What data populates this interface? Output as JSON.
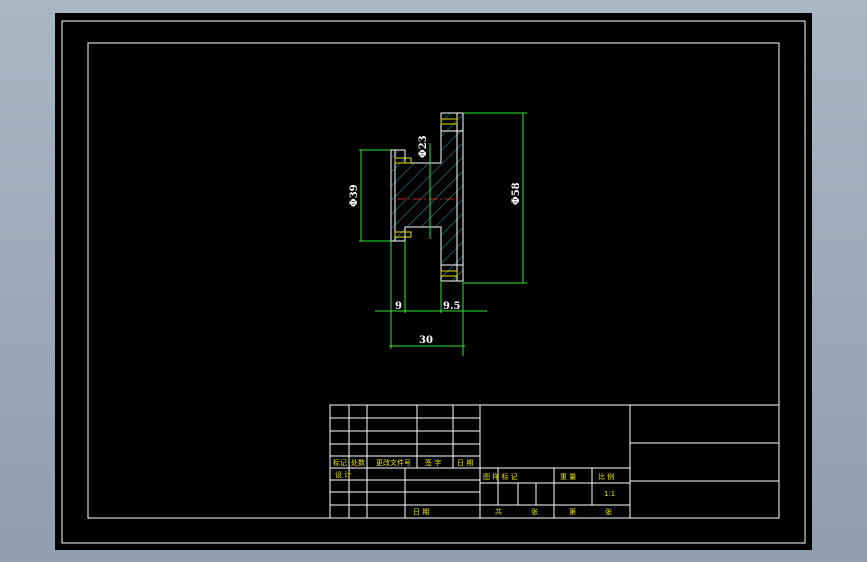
{
  "drawing": {
    "dimensions": {
      "dia_hub": "Φ39",
      "dia_bore": "Φ23",
      "dia_outer": "Φ58",
      "width_left": "9",
      "width_right": "9.5",
      "total_width": "30"
    },
    "title_block": {
      "rev_mark": "标记",
      "rev_count": "处数",
      "rev_doc": "更改文件号",
      "sign": "签 字",
      "date_label": "日 期",
      "design": "设 计",
      "stage_mark": "图 样 标 记",
      "weight": "重 量",
      "scale_label": "比 例",
      "scale_value": "1:1",
      "total": "共",
      "sheet_unit": "张",
      "sheet_no": "第",
      "sheet_unit2": "张",
      "date2": "日 期"
    },
    "colors": {
      "outline": "#ffffff",
      "dimension": "#2ee62e",
      "hatch": "#29c4d2",
      "thread": "#e0e000",
      "center": "#ff3030"
    }
  }
}
